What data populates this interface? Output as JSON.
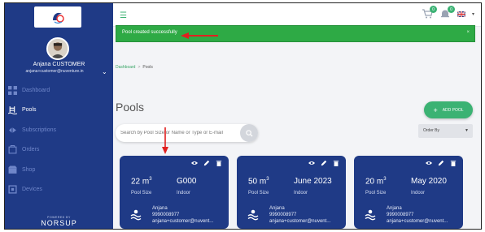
{
  "sidebar": {
    "user_name": "Anjana CUSTOMER",
    "user_email": "anjana+customer@nuventure.in",
    "items": [
      {
        "label": "Dashboard",
        "icon": "dashboard-icon"
      },
      {
        "label": "Pools",
        "icon": "pool-ladder-icon"
      },
      {
        "label": "Subscriptions",
        "icon": "subscriptions-icon"
      },
      {
        "label": "Orders",
        "icon": "orders-icon"
      },
      {
        "label": "Shop",
        "icon": "shop-icon"
      },
      {
        "label": "Devices",
        "icon": "devices-icon"
      }
    ],
    "brand_tagline": "POWERED BY",
    "brand_name": "NORSUP"
  },
  "topbar": {
    "cart_count": "0",
    "notifications_count": "0"
  },
  "alert": {
    "message": "Pool created successfully",
    "close": "×"
  },
  "breadcrumb": {
    "root": "Dashboard",
    "separator": ">",
    "current": "Pools"
  },
  "page": {
    "title": "Pools",
    "add_button": "ADD POOL"
  },
  "search": {
    "placeholder": "Search by Pool Size or Name or Type or E-mail"
  },
  "order": {
    "label": "Order By"
  },
  "cards": [
    {
      "size": "22 m",
      "unit_sup": "3",
      "size_label": "Pool Size",
      "name": "G000",
      "type": "Indoor",
      "owner": "Anjana",
      "phone": "9990008977",
      "email": "anjana+customer@nuvent..."
    },
    {
      "size": "50 m",
      "unit_sup": "3",
      "size_label": "Pool Size",
      "name": "June 2023",
      "type": "Indoor",
      "owner": "Anjana",
      "phone": "9990008977",
      "email": "anjana+customer@nuvent..."
    },
    {
      "size": "20 m",
      "unit_sup": "3",
      "size_label": "Pool Size",
      "name": "May 2020",
      "type": "Indoor",
      "owner": "Anjana",
      "phone": "9990008977",
      "email": "anjana+customer@nuvent..."
    }
  ],
  "colors": {
    "sidebar": "#1f3a86",
    "accent": "#3bb273",
    "alert": "#2eaa45",
    "annotation": "#e02020"
  }
}
